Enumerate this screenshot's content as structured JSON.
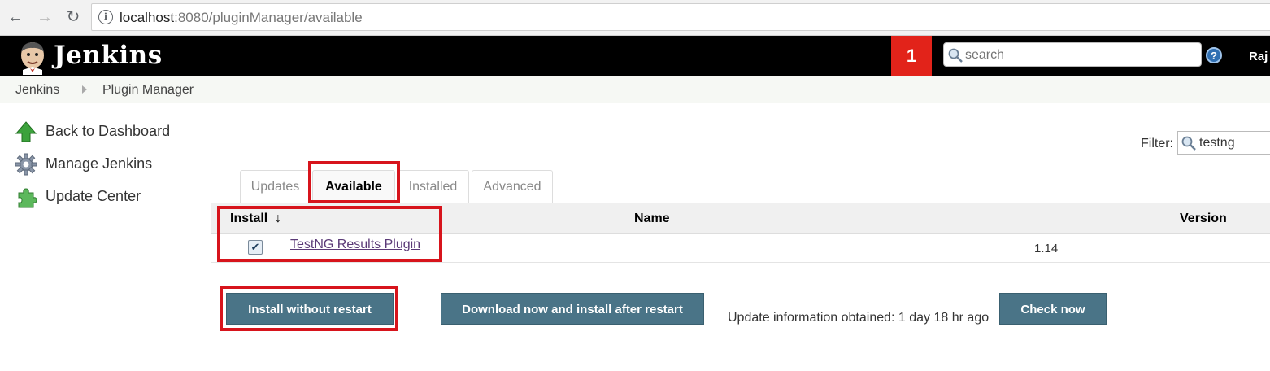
{
  "browser": {
    "url_host": "localhost",
    "url_path": ":8080/pluginManager/available"
  },
  "header": {
    "brand": "Jenkins",
    "notification_count": "1",
    "search_placeholder": "search",
    "user_name": "Raj"
  },
  "breadcrumb": [
    "Jenkins",
    "Plugin Manager"
  ],
  "sidebar": {
    "items": [
      {
        "label": "Back to Dashboard",
        "icon": "up-arrow-icon"
      },
      {
        "label": "Manage Jenkins",
        "icon": "gear-icon"
      },
      {
        "label": "Update Center",
        "icon": "puzzle-icon"
      }
    ]
  },
  "filter": {
    "label": "Filter:",
    "value": "testng"
  },
  "tabs": [
    {
      "label": "Updates",
      "active": false
    },
    {
      "label": "Available",
      "active": true
    },
    {
      "label": "Installed",
      "active": false
    },
    {
      "label": "Advanced",
      "active": false
    }
  ],
  "table": {
    "columns": [
      "Install",
      "Name",
      "Version"
    ],
    "sort_indicator": "↓",
    "rows": [
      {
        "checked": true,
        "name": "TestNG Results Plugin",
        "version": "1.14"
      }
    ]
  },
  "actions": {
    "install_without_restart": "Install without restart",
    "download_install_after_restart": "Download now and install after restart",
    "update_info": "Update information obtained: 1 day 18 hr ago",
    "check_now": "Check now"
  },
  "colors": {
    "header_bg": "#000000",
    "notification_bg": "#e2231a",
    "button_bg": "#4a7487",
    "highlight": "#d7141c"
  }
}
